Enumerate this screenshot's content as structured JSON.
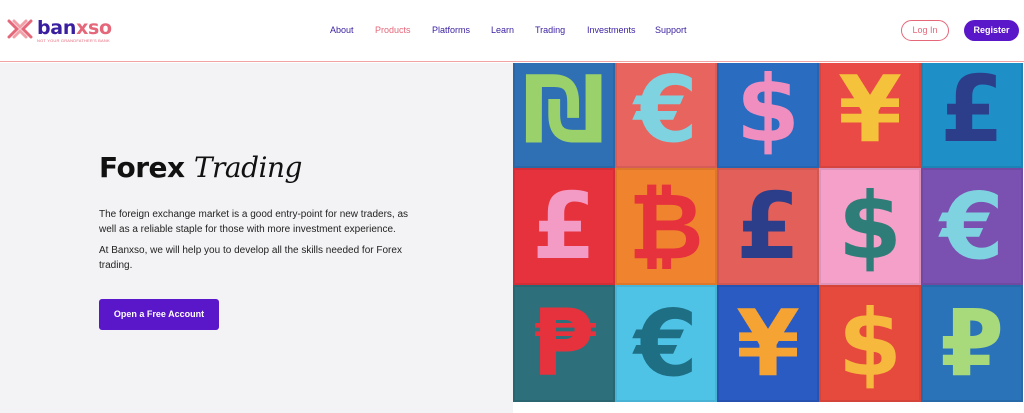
{
  "brand": {
    "name_part1": "ban",
    "name_part2": "xso",
    "tagline": "not your grandfather's bank"
  },
  "nav": {
    "items": [
      {
        "label": "About",
        "active": false
      },
      {
        "label": "Products",
        "active": true
      },
      {
        "label": "Platforms",
        "active": false
      },
      {
        "label": "Learn",
        "active": false
      },
      {
        "label": "Trading",
        "active": false
      },
      {
        "label": "Investments",
        "active": false
      },
      {
        "label": "Support",
        "active": false
      }
    ],
    "login_label": "Log In",
    "register_label": "Register"
  },
  "hero": {
    "title_plain": "Forex",
    "title_italic": "Trading",
    "paragraph1": "The foreign exchange market is a good entry-point for new traders, as well as a reliable staple for those with more investment experience.",
    "paragraph2": "At Banxso, we will help you to develop all the skills needed for Forex trading.",
    "cta_label": "Open a Free Account"
  },
  "mosaic": {
    "tiles": [
      {
        "symbol": "₪",
        "bg": "#2f6fb3",
        "fg": "#9bd16a"
      },
      {
        "symbol": "€",
        "bg": "#e8645f",
        "fg": "#7fd3e0"
      },
      {
        "symbol": "$",
        "bg": "#2a6cc0",
        "fg": "#f08fbf"
      },
      {
        "symbol": "¥",
        "bg": "#e94a45",
        "fg": "#f5c33b"
      },
      {
        "symbol": "£",
        "bg": "#1f8fc7",
        "fg": "#2c3d8a"
      },
      {
        "symbol": "£",
        "bg": "#e5323d",
        "fg": "#f39bc4"
      },
      {
        "symbol": "₿",
        "bg": "#f0832e",
        "fg": "#e5323d"
      },
      {
        "symbol": "£",
        "bg": "#e3605a",
        "fg": "#2c3d8a"
      },
      {
        "symbol": "$",
        "bg": "#f4a0c8",
        "fg": "#2e7d78"
      },
      {
        "symbol": "€",
        "bg": "#7a50b0",
        "fg": "#7fd3e0"
      },
      {
        "symbol": "₱",
        "bg": "#2e6f7c",
        "fg": "#e5323d"
      },
      {
        "symbol": "€",
        "bg": "#4fc3e6",
        "fg": "#1e6e84"
      },
      {
        "symbol": "¥",
        "bg": "#2a5bc2",
        "fg": "#f5a333"
      },
      {
        "symbol": "$",
        "bg": "#e64a3d",
        "fg": "#f6b93d"
      },
      {
        "symbol": "₽",
        "bg": "#2b73b8",
        "fg": "#a8d97a"
      }
    ]
  }
}
